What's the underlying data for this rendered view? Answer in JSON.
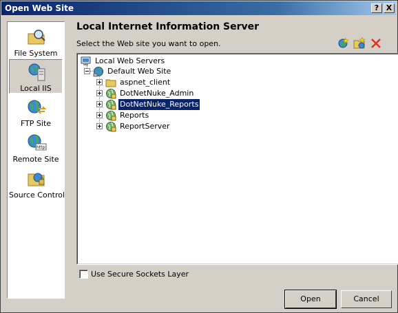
{
  "window": {
    "title": "Open Web Site"
  },
  "title_buttons": {
    "help": "?",
    "close": "X"
  },
  "sidebar": {
    "items": [
      {
        "label": "File System",
        "icon": "folder-search-icon",
        "selected": false
      },
      {
        "label": "Local IIS",
        "icon": "globe-server-icon",
        "selected": true
      },
      {
        "label": "FTP Site",
        "icon": "globe-ftp-icon",
        "selected": false
      },
      {
        "label": "Remote Site",
        "icon": "globe-http-icon",
        "selected": false
      },
      {
        "label": "Source Control",
        "icon": "source-control-icon",
        "selected": false
      }
    ]
  },
  "main": {
    "heading": "Local Internet Information Server",
    "prompt": "Select the Web site you want to open.",
    "toolbar": {
      "icons": [
        "create-web-application-icon",
        "create-virtual-directory-icon",
        "delete-icon"
      ]
    },
    "tree": {
      "root": "Local Web Servers",
      "site": "Default Web Site",
      "children": [
        {
          "label": "aspnet_client",
          "icon": "folder-icon",
          "selected": false
        },
        {
          "label": "DotNetNuke_Admin",
          "icon": "web-app-icon",
          "selected": false
        },
        {
          "label": "DotNetNuke_Reports",
          "icon": "web-app-icon",
          "selected": true
        },
        {
          "label": "Reports",
          "icon": "web-app-icon",
          "selected": false
        },
        {
          "label": "ReportServer",
          "icon": "web-app-icon",
          "selected": false
        }
      ]
    },
    "ssl_label": "Use Secure Sockets Layer",
    "ssl_checked": false
  },
  "buttons": {
    "open": "Open",
    "cancel": "Cancel"
  },
  "colors": {
    "titlebar": "#0a246a",
    "selection": "#0a246a",
    "face": "#d4d0c8"
  }
}
